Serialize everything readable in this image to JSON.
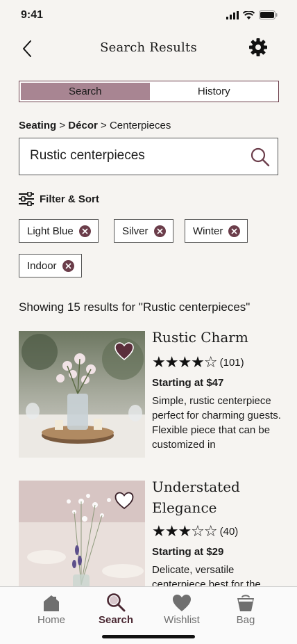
{
  "status": {
    "time": "9:41"
  },
  "header": {
    "title": "Search Results"
  },
  "segments": [
    {
      "label": "Search",
      "active": true
    },
    {
      "label": "History",
      "active": false
    }
  ],
  "breadcrumb": {
    "level1": "Seating",
    "sep1": ">",
    "level2": "Décor",
    "sep2": ">",
    "level3": "Centerpieces"
  },
  "search": {
    "value": "Rustic centerpieces"
  },
  "filter": {
    "label": "Filter & Sort"
  },
  "chips": [
    {
      "label": "Light Blue"
    },
    {
      "label": "Silver"
    },
    {
      "label": "Winter"
    },
    {
      "label": "Indoor"
    }
  ],
  "results": {
    "summary": "Showing 15 results for \"Rustic centerpieces\""
  },
  "products": [
    {
      "title": "Rustic Charm",
      "rating": 4,
      "stars": "★★★★☆",
      "reviews": "(101)",
      "price": "Starting at $47",
      "description": "Simple, rustic centerpiece perfect for charming guests. Flexible piece that can be customized in",
      "favorited": true
    },
    {
      "title": "Understated Elegance",
      "rating": 3,
      "stars": "★★★☆☆",
      "reviews": "(40)",
      "price": "Starting at $29",
      "description": "Delicate, versatile centerpiece best for the",
      "favorited": false
    }
  ],
  "tabs": [
    {
      "label": "Home",
      "icon": "home-icon"
    },
    {
      "label": "Search",
      "icon": "search-icon",
      "active": true
    },
    {
      "label": "Wishlist",
      "icon": "heart-icon"
    },
    {
      "label": "Bag",
      "icon": "bag-icon"
    }
  ],
  "colors": {
    "accent": "#6b3d4a",
    "segment_active": "#a88592",
    "background": "#f6f4f1"
  }
}
